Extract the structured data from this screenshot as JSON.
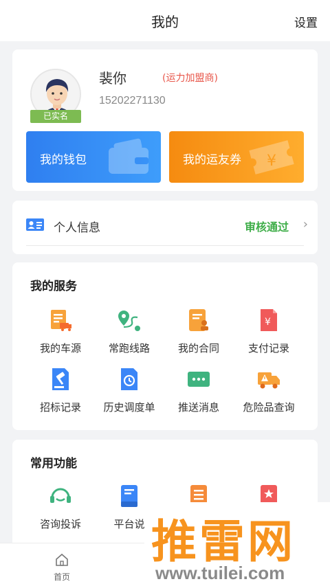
{
  "header": {
    "title": "我的",
    "settings_label": "设置"
  },
  "profile": {
    "name": "裴你",
    "role": "(运力加盟商)",
    "phone": "15202271130",
    "verified_label": "已实名",
    "wallet_label": "我的钱包",
    "coupon_label": "我的运友券"
  },
  "info": {
    "label": "个人信息",
    "status": "审核通过"
  },
  "services": {
    "title": "我的服务",
    "items": [
      {
        "label": "我的车源",
        "icon": "truck-document-icon"
      },
      {
        "label": "常跑线路",
        "icon": "route-pin-icon"
      },
      {
        "label": "我的合同",
        "icon": "contract-icon"
      },
      {
        "label": "支付记录",
        "icon": "payment-record-icon"
      },
      {
        "label": "招标记录",
        "icon": "bid-record-icon"
      },
      {
        "label": "历史调度单",
        "icon": "history-dispatch-icon"
      },
      {
        "label": "推送消息",
        "icon": "message-icon"
      },
      {
        "label": "危险品查询",
        "icon": "hazmat-truck-icon"
      }
    ]
  },
  "features": {
    "title": "常用功能",
    "items": [
      {
        "label": "咨询投诉",
        "icon": "headset-icon"
      },
      {
        "label": "平台说",
        "icon": "book-icon"
      },
      {
        "label": "",
        "icon": "list-icon"
      },
      {
        "label": "",
        "icon": "bookmark-star-icon"
      }
    ]
  },
  "tabbar": {
    "home_label": "首页"
  },
  "watermark": {
    "big": "推雷网",
    "url": "www.tuilei.com"
  },
  "colors": {
    "wallet": "#2f7ff0",
    "coupon": "#f58b10",
    "approved": "#3fae49",
    "role": "#e8564a"
  }
}
